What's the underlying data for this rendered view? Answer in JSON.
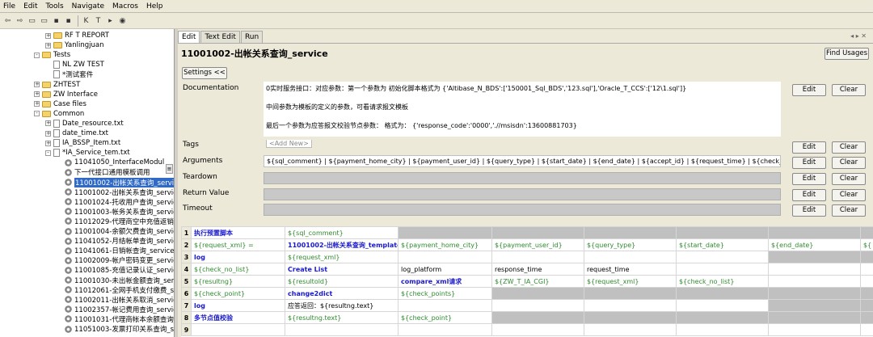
{
  "menu": [
    "File",
    "Edit",
    "Tools",
    "Navigate",
    "Macros",
    "Help"
  ],
  "tree": [
    {
      "label": "RF T REPORT",
      "kind": "folder",
      "depth": 2,
      "exp": "+"
    },
    {
      "label": "Yanlingjuan",
      "kind": "folder",
      "depth": 2,
      "exp": "+"
    },
    {
      "label": "Tests",
      "kind": "folder",
      "depth": 1,
      "exp": "-"
    },
    {
      "label": "NL ZW TEST",
      "kind": "file",
      "depth": 2,
      "exp": ""
    },
    {
      "label": "*测试套件",
      "kind": "file",
      "depth": 2,
      "exp": ""
    },
    {
      "label": "ZHTEST",
      "kind": "folder",
      "depth": 1,
      "exp": "+"
    },
    {
      "label": "ZW Interface",
      "kind": "folder",
      "depth": 1,
      "exp": "+"
    },
    {
      "label": "Case files",
      "kind": "folder",
      "depth": 1,
      "exp": "+"
    },
    {
      "label": "Common",
      "kind": "folder",
      "depth": 1,
      "exp": "-"
    },
    {
      "label": "Date_resource.txt",
      "kind": "file",
      "depth": 2,
      "exp": "+"
    },
    {
      "label": "date_time.txt",
      "kind": "file",
      "depth": 2,
      "exp": "+"
    },
    {
      "label": "IA_BSSP_Item.txt",
      "kind": "file",
      "depth": 2,
      "exp": "+"
    },
    {
      "label": "*IA_Service_tem.txt",
      "kind": "file",
      "depth": 2,
      "exp": "-"
    },
    {
      "label": "11041050_InterfaceModul",
      "kind": "gear",
      "depth": 3,
      "exp": ""
    },
    {
      "label": "下一代接口通用模板调用",
      "kind": "gear",
      "depth": 3,
      "exp": ""
    },
    {
      "label": "11001002-出帐关系查询_service",
      "kind": "gear",
      "depth": 3,
      "exp": "",
      "selected": true
    },
    {
      "label": "11001002-出帐关系查询_service_ng",
      "kind": "gear",
      "depth": 3,
      "exp": ""
    },
    {
      "label": "11001024-托收用户查询_service",
      "kind": "gear",
      "depth": 3,
      "exp": ""
    },
    {
      "label": "11001003-帐务关系查询_service",
      "kind": "gear",
      "depth": 3,
      "exp": ""
    },
    {
      "label": "11012029-代理商空中充值返销_servic",
      "kind": "gear",
      "depth": 3,
      "exp": ""
    },
    {
      "label": "11001004-余额欠费查询_service",
      "kind": "gear",
      "depth": 3,
      "exp": ""
    },
    {
      "label": "11041052-月结帐单查询_service",
      "kind": "gear",
      "depth": 3,
      "exp": ""
    },
    {
      "label": "11041061-日销帐查询_service",
      "kind": "gear",
      "depth": 3,
      "exp": ""
    },
    {
      "label": "11002009-帐户密码变更_service",
      "kind": "gear",
      "depth": 3,
      "exp": ""
    },
    {
      "label": "11001085-充值记录认证_service",
      "kind": "gear",
      "depth": 3,
      "exp": ""
    },
    {
      "label": "11001030-未出帐金额查询_service",
      "kind": "gear",
      "depth": 3,
      "exp": ""
    },
    {
      "label": "11012061-全网手机支付缴费_servic",
      "kind": "gear",
      "depth": 3,
      "exp": ""
    },
    {
      "label": "11002011-出帐关系取消_service",
      "kind": "gear",
      "depth": 3,
      "exp": ""
    },
    {
      "label": "11002357-帐记费用查询_service",
      "kind": "gear",
      "depth": 3,
      "exp": ""
    },
    {
      "label": "11001031-代理商帐本余额查询_servic",
      "kind": "gear",
      "depth": 3,
      "exp": ""
    },
    {
      "label": "11051003-发票打印关系查询_service",
      "kind": "gear",
      "depth": 3,
      "exp": ""
    }
  ],
  "tabs": [
    "Edit",
    "Text Edit",
    "Run"
  ],
  "title": "11001002-出帐关系查询_service",
  "find_usages": "Find Usages",
  "settings": "Settings <<",
  "labels": {
    "documentation": "Documentation",
    "tags": "Tags",
    "arguments": "Arguments",
    "teardown": "Teardown",
    "return_value": "Return Value",
    "timeout": "Timeout"
  },
  "doc_lines": [
    "0实时服务接口：对应参数：第一个参数为 初始化脚本格式为 {'Altibase_N_BDS':['150001_Sql_BDS','123.sql'],'Oracle_T_CCS':['12\\1.sql']}",
    "中间参数为模板的定义的参数，可看请求报文模板",
    "最后一个参数为应答报文校验节点参数： 格式为： {'response_code':'0000','.//msisdn':13600881703}"
  ],
  "tags_placeholder": "<Add New>",
  "arguments_value": "${sql_comment} | ${payment_home_city} | ${payment_user_id} | ${query_type} | ${start_date} | ${end_date} | ${accept_id} | ${request_time} | ${check_points}",
  "edit_label": "Edit",
  "clear_label": "Clear",
  "grid": [
    {
      "n": "1",
      "cells": [
        [
          "执行预置脚本",
          "kw"
        ],
        [
          "${sql_comment}",
          "var"
        ],
        [
          "",
          "g"
        ],
        [
          "",
          "g"
        ],
        [
          "",
          "g"
        ],
        [
          "",
          "g"
        ],
        [
          "",
          "g"
        ],
        [
          "",
          "g"
        ]
      ]
    },
    {
      "n": "2",
      "cells": [
        [
          "${request_xml} =",
          "var"
        ],
        [
          "11001002-出帐关系查询_template",
          "kw"
        ],
        [
          "${payment_home_city}",
          "var"
        ],
        [
          "${payment_user_id}",
          "var"
        ],
        [
          "${query_type}",
          "var"
        ],
        [
          "${start_date}",
          "var"
        ],
        [
          "${end_date}",
          "var"
        ],
        [
          "${",
          "var"
        ]
      ]
    },
    {
      "n": "3",
      "cells": [
        [
          "log",
          "kw"
        ],
        [
          "${request_xml}",
          "var"
        ],
        [
          "",
          ""
        ],
        [
          "",
          ""
        ],
        [
          "",
          ""
        ],
        [
          "",
          ""
        ],
        [
          "",
          "g"
        ],
        [
          "",
          "g"
        ]
      ]
    },
    {
      "n": "4",
      "cells": [
        [
          "${check_no_list}",
          "var"
        ],
        [
          "Create List",
          "kw"
        ],
        [
          "log_platform",
          "txt"
        ],
        [
          "response_time",
          "txt"
        ],
        [
          "request_time",
          "txt"
        ],
        [
          "",
          ""
        ],
        [
          "",
          ""
        ],
        [
          "",
          ""
        ]
      ]
    },
    {
      "n": "5",
      "cells": [
        [
          "${resultng}",
          "var"
        ],
        [
          "${resultold}",
          "var"
        ],
        [
          "compare_xml请求",
          "kw"
        ],
        [
          "${ZW_T_IA_CGI}",
          "var"
        ],
        [
          "${request_xml}",
          "var"
        ],
        [
          "${check_no_list}",
          "var"
        ],
        [
          "",
          ""
        ],
        [
          "",
          ""
        ]
      ]
    },
    {
      "n": "6",
      "cells": [
        [
          "${check_point}",
          "var"
        ],
        [
          "change2dict",
          "kw"
        ],
        [
          "${check_points}",
          "var"
        ],
        [
          "",
          "g"
        ],
        [
          "",
          "g"
        ],
        [
          "",
          "g"
        ],
        [
          "",
          "g"
        ],
        [
          "",
          "g"
        ]
      ]
    },
    {
      "n": "7",
      "cells": [
        [
          "log",
          "kw"
        ],
        [
          "应答返回：${resultng.text}",
          "txt"
        ],
        [
          "",
          ""
        ],
        [
          "",
          ""
        ],
        [
          "",
          ""
        ],
        [
          "",
          ""
        ],
        [
          "",
          "g"
        ],
        [
          "",
          "g"
        ]
      ]
    },
    {
      "n": "8",
      "cells": [
        [
          "多节点值校验",
          "kw"
        ],
        [
          "${resultng.text}",
          "var"
        ],
        [
          "${check_point}",
          "var"
        ],
        [
          "",
          "g"
        ],
        [
          "",
          "g"
        ],
        [
          "",
          "g"
        ],
        [
          "",
          "g"
        ],
        [
          "",
          "g"
        ]
      ]
    },
    {
      "n": "9",
      "cells": [
        [
          "",
          ""
        ],
        [
          "",
          ""
        ],
        [
          "",
          ""
        ],
        [
          "",
          ""
        ],
        [
          "",
          ""
        ],
        [
          "",
          ""
        ],
        [
          "",
          ""
        ],
        [
          "",
          ""
        ]
      ]
    }
  ]
}
